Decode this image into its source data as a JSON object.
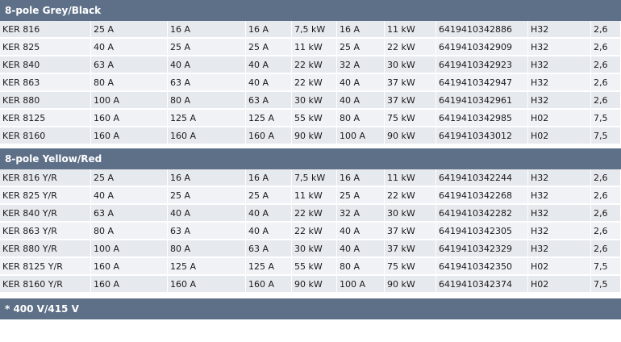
{
  "sections": [
    {
      "title": "8-pole Grey/Black",
      "rows": [
        [
          "KER 816",
          "25 A",
          "16 A",
          "16 A",
          "7,5 kW",
          "16 A",
          "11 kW",
          "6419410342886",
          "H32",
          "2,6"
        ],
        [
          "KER 825",
          "40 A",
          "25 A",
          "25 A",
          "11 kW",
          "25 A",
          "22 kW",
          "6419410342909",
          "H32",
          "2,6"
        ],
        [
          "KER 840",
          "63 A",
          "40 A",
          "40 A",
          "22 kW",
          "32 A",
          "30 kW",
          "6419410342923",
          "H32",
          "2,6"
        ],
        [
          "KER 863",
          "80 A",
          "63 A",
          "40 A",
          "22 kW",
          "40 A",
          "37 kW",
          "6419410342947",
          "H32",
          "2,6"
        ],
        [
          "KER 880",
          "100 A",
          "80 A",
          "63 A",
          "30 kW",
          "40 A",
          "37 kW",
          "6419410342961",
          "H32",
          "2,6"
        ],
        [
          "KER 8125",
          "160 A",
          "125 A",
          "125 A",
          "55 kW",
          "80 A",
          "75 kW",
          "6419410342985",
          "H02",
          "7,5"
        ],
        [
          "KER 8160",
          "160 A",
          "160 A",
          "160 A",
          "90 kW",
          "100 A",
          "90 kW",
          "6419410343012",
          "H02",
          "7,5"
        ]
      ]
    },
    {
      "title": "8-pole Yellow/Red",
      "rows": [
        [
          "KER 816 Y/R",
          "25 A",
          "16 A",
          "16 A",
          "7,5 kW",
          "16 A",
          "11 kW",
          "6419410342244",
          "H32",
          "2,6"
        ],
        [
          "KER 825 Y/R",
          "40 A",
          "25 A",
          "25 A",
          "11 kW",
          "25 A",
          "22 kW",
          "6419410342268",
          "H32",
          "2,6"
        ],
        [
          "KER 840 Y/R",
          "63 A",
          "40 A",
          "40 A",
          "22 kW",
          "32 A",
          "30 kW",
          "6419410342282",
          "H32",
          "2,6"
        ],
        [
          "KER 863 Y/R",
          "80 A",
          "63 A",
          "40 A",
          "22 kW",
          "40 A",
          "37 kW",
          "6419410342305",
          "H32",
          "2,6"
        ],
        [
          "KER 880 Y/R",
          "100 A",
          "80 A",
          "63 A",
          "30 kW",
          "40 A",
          "37 kW",
          "6419410342329",
          "H32",
          "2,6"
        ],
        [
          "KER 8125 Y/R",
          "160 A",
          "125 A",
          "125 A",
          "55 kW",
          "80 A",
          "75 kW",
          "6419410342350",
          "H02",
          "7,5"
        ],
        [
          "KER 8160 Y/R",
          "160 A",
          "160 A",
          "160 A",
          "90 kW",
          "100 A",
          "90 kW",
          "6419410342374",
          "H02",
          "7,5"
        ]
      ]
    }
  ],
  "footer": "* 400 V/415 V",
  "colors": {
    "header_bg": "#5e7088",
    "row_a": "#e6e9ee",
    "row_b": "#f0f2f5"
  }
}
